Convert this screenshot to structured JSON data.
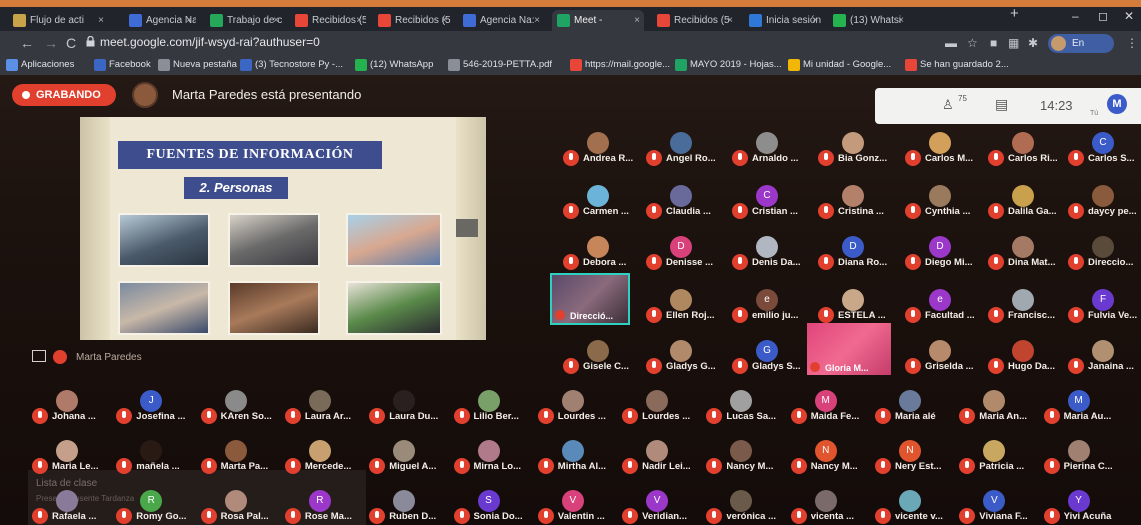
{
  "browser": {
    "tabs": [
      {
        "label": "Flujo de acti",
        "color": "#c7a44a"
      },
      {
        "label": "Agencia Na:",
        "color": "#3f6bd6"
      },
      {
        "label": "Trabajo de c",
        "color": "#26a85a"
      },
      {
        "label": "Recibidos (5",
        "color": "#e9463a"
      },
      {
        "label": "Recibidos (5",
        "color": "#e9463a"
      },
      {
        "label": "Agencia Na:",
        "color": "#3f6bd6"
      },
      {
        "label": "Meet - ",
        "color": "#1fa463"
      },
      {
        "label": "Recibidos (5",
        "color": "#e9463a"
      },
      {
        "label": "Inicia sesión",
        "color": "#2f78d8"
      },
      {
        "label": "(13) Whatsi",
        "color": "#25b350"
      }
    ],
    "new_tab": "+",
    "window_controls": [
      "–",
      "◻",
      "✕"
    ],
    "url": "meet.google.com/jif-wsyd-rai?authuser=0",
    "profile_label": "En pausa",
    "bookmarks": [
      {
        "label": "Aplicaciones",
        "color": "#5c8fe6"
      },
      {
        "label": "Facebook",
        "color": "#3b66c4"
      },
      {
        "label": "Nueva pestaña",
        "color": "#8a8f97"
      },
      {
        "label": "(3) Tecnostore Py -...",
        "color": "#3b66c4"
      },
      {
        "label": "(12) WhatsApp",
        "color": "#25b350"
      },
      {
        "label": "546-2019-PETTA.pdf",
        "color": "#8a8f97"
      },
      {
        "label": "https://mail.google...",
        "color": "#e9463a"
      },
      {
        "label": "MAYO 2019 - Hojas...",
        "color": "#1fa463"
      },
      {
        "label": "Mi unidad - Google...",
        "color": "#f2b705"
      },
      {
        "label": "Se han guardado 2...",
        "color": "#e9463a"
      }
    ]
  },
  "meet": {
    "recording_label": "GRABANDO",
    "presenting_text": "Marta Paredes está presentando",
    "participant_count": "75",
    "time": "14:23",
    "self_label": "Tú",
    "self_initial": "M",
    "pinned_name": "Marta Paredes"
  },
  "slide": {
    "title": "FUENTES DE INFORMACIÓN",
    "subtitle": "2. Personas"
  },
  "videos": [
    {
      "name": "Direcció..."
    },
    {
      "name": "Gloria M..."
    }
  ],
  "participants": [
    {
      "name": "Andrea R...",
      "initial": "",
      "color": "#a2704e"
    },
    {
      "name": "Angel Ro...",
      "initial": "",
      "color": "#4a6c9a"
    },
    {
      "name": "Arnaldo ...",
      "initial": "",
      "color": "#8d8d8d"
    },
    {
      "name": "Bia Gonz...",
      "initial": "",
      "color": "#c49a7c"
    },
    {
      "name": "Carlos M...",
      "initial": "",
      "color": "#d2a05a"
    },
    {
      "name": "Carlos Ri...",
      "initial": "",
      "color": "#b06c52"
    },
    {
      "name": "Carlos S...",
      "initial": "C",
      "color": "#3b5bc9"
    },
    {
      "name": "Carmen ...",
      "initial": "",
      "color": "#6bb3d8"
    },
    {
      "name": "Claudia ...",
      "initial": "",
      "color": "#6a6a9a"
    },
    {
      "name": "Cristian ...",
      "initial": "C",
      "color": "#9b38c9"
    },
    {
      "name": "Cristina ...",
      "initial": "",
      "color": "#b3816a"
    },
    {
      "name": "Cynthia ...",
      "initial": "",
      "color": "#9a7a5c"
    },
    {
      "name": "Dalila Ga...",
      "initial": "",
      "color": "#c9a04c"
    },
    {
      "name": "daycy pe...",
      "initial": "",
      "color": "#8a5a3c"
    },
    {
      "name": "Debora ...",
      "initial": "",
      "color": "#c6865a"
    },
    {
      "name": "Denisse ...",
      "initial": "D",
      "color": "#d8417a"
    },
    {
      "name": "Denis Da...",
      "initial": "",
      "color": "#b0b7c0"
    },
    {
      "name": "Diana Ro...",
      "initial": "D",
      "color": "#3b5bc9"
    },
    {
      "name": "Diego Mi...",
      "initial": "D",
      "color": "#9b38c9"
    },
    {
      "name": "Dina Mat...",
      "initial": "",
      "color": "#a47a64"
    },
    {
      "name": "Direccio...",
      "initial": "",
      "color": "#5a4a3a"
    },
    {
      "name": "Ellen Roj...",
      "initial": "",
      "color": "#b08860"
    },
    {
      "name": "emilio ju...",
      "initial": "e",
      "color": "#7a4a3a"
    },
    {
      "name": "ESTELA ...",
      "initial": "",
      "color": "#c8a888"
    },
    {
      "name": "Facultad ...",
      "initial": "e",
      "color": "#9b38c9"
    },
    {
      "name": "Francisc...",
      "initial": "",
      "color": "#a0a8b0"
    },
    {
      "name": "Fulvia Ve...",
      "initial": "F",
      "color": "#6a3ad0"
    },
    {
      "name": "Gisele C...",
      "initial": "",
      "color": "#8a6a4a"
    },
    {
      "name": "Gladys G...",
      "initial": "",
      "color": "#b08a6a"
    },
    {
      "name": "Gladys S...",
      "initial": "G",
      "color": "#3b5bc9"
    },
    {
      "name": "Griselda ...",
      "initial": "",
      "color": "#b68a6a"
    },
    {
      "name": "Hugo Da...",
      "initial": "",
      "color": "#c0442e"
    },
    {
      "name": "Janaina ...",
      "initial": "",
      "color": "#b09070"
    },
    {
      "name": "Johana ...",
      "initial": "",
      "color": "#b07a6a"
    },
    {
      "name": "Josefina ...",
      "initial": "J",
      "color": "#3b5bc9"
    },
    {
      "name": "KAren So...",
      "initial": "",
      "color": "#8a8a8a"
    },
    {
      "name": "Laura Ar...",
      "initial": "",
      "color": "#7a6a5a"
    },
    {
      "name": "Laura Du...",
      "initial": "",
      "color": "#2a2020"
    },
    {
      "name": "Lilio Ber...",
      "initial": "",
      "color": "#7aa06a"
    },
    {
      "name": "Lourdes ...",
      "initial": "",
      "color": "#a08070"
    },
    {
      "name": "Lourdes ...",
      "initial": "",
      "color": "#8a6a5a"
    },
    {
      "name": "Lucas Sa...",
      "initial": "",
      "color": "#a0a0a0"
    },
    {
      "name": "Maida Fe...",
      "initial": "M",
      "color": "#d8417a"
    },
    {
      "name": "Maria alé",
      "initial": "",
      "color": "#6a7a9a"
    },
    {
      "name": "Maria An...",
      "initial": "",
      "color": "#b08a6a"
    },
    {
      "name": "Maria Au...",
      "initial": "M",
      "color": "#3b5bc9"
    },
    {
      "name": "Maria Le...",
      "initial": "",
      "color": "#c4a08a"
    },
    {
      "name": "mañela ...",
      "initial": "",
      "color": "#2a1a14"
    },
    {
      "name": "Marta Pa...",
      "initial": "",
      "color": "#8b5a3c"
    },
    {
      "name": "Mercede...",
      "initial": "",
      "color": "#c8a070"
    },
    {
      "name": "Miguel A...",
      "initial": "",
      "color": "#9a8a7a"
    },
    {
      "name": "Mirna Lo...",
      "initial": "",
      "color": "#b07a8a"
    },
    {
      "name": "Mirtha Al...",
      "initial": "",
      "color": "#5a8aba"
    },
    {
      "name": "Nadir Lei...",
      "initial": "",
      "color": "#b08a7a"
    },
    {
      "name": "Nancy M...",
      "initial": "",
      "color": "#7a5a4a"
    },
    {
      "name": "Nancy M...",
      "initial": "N",
      "color": "#e0542e"
    },
    {
      "name": "Nery Est...",
      "initial": "N",
      "color": "#e0542e"
    },
    {
      "name": "Patricia ...",
      "initial": "",
      "color": "#c8a860"
    },
    {
      "name": "Pierina C...",
      "initial": "",
      "color": "#a08070"
    },
    {
      "name": "Rafaela ...",
      "initial": "",
      "color": "#8a7a9a"
    },
    {
      "name": "Romy Go...",
      "initial": "R",
      "color": "#4aa84a"
    },
    {
      "name": "Rosa Pal...",
      "initial": "",
      "color": "#b08a7a"
    },
    {
      "name": "Rose Ma...",
      "initial": "R",
      "color": "#9b38c9"
    },
    {
      "name": "Ruben D...",
      "initial": "",
      "color": "#8a8a9a"
    },
    {
      "name": "Sonia Do...",
      "initial": "S",
      "color": "#6a3ad0"
    },
    {
      "name": "Valentin ...",
      "initial": "V",
      "color": "#d8417a"
    },
    {
      "name": "Veridian...",
      "initial": "V",
      "color": "#9b38c9"
    },
    {
      "name": "verónica ...",
      "initial": "",
      "color": "#6a5a4a"
    },
    {
      "name": "vicenta ...",
      "initial": "",
      "color": "#7a6a6a"
    },
    {
      "name": "vicente v...",
      "initial": "",
      "color": "#6aa8b8"
    },
    {
      "name": "Viviana F...",
      "initial": "V",
      "color": "#3b5bc9"
    },
    {
      "name": "Yivi Acuña",
      "initial": "Y",
      "color": "#6a3ad0"
    }
  ],
  "background_window": {
    "title": "Lista de clase",
    "line": "Presente   Ausente   Tardanza"
  }
}
